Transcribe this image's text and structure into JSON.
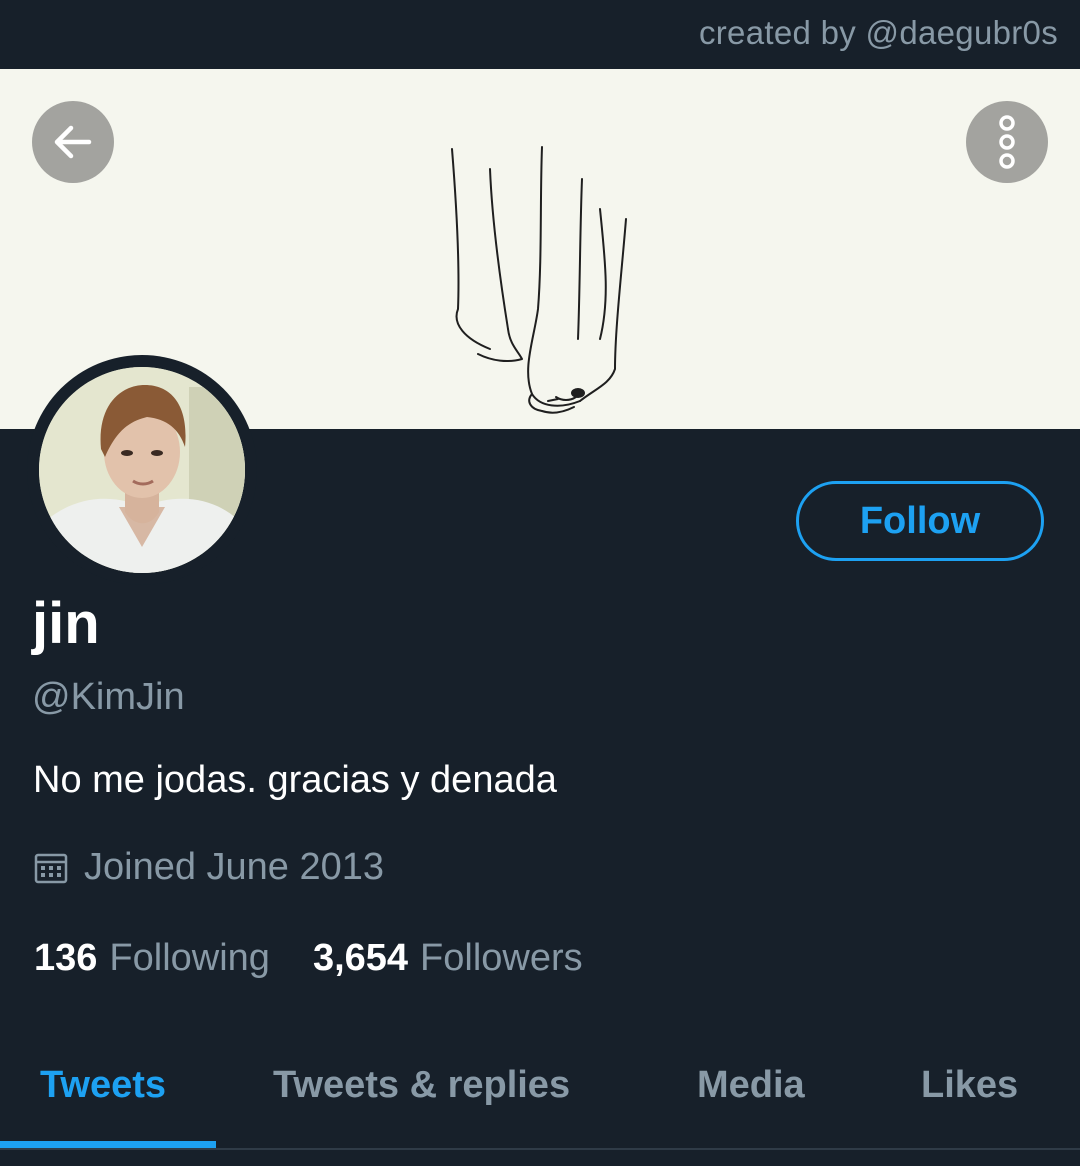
{
  "header": {
    "credit": "created by @daegubr0s"
  },
  "banner": {
    "back_icon": "arrow-left-icon",
    "more_icon": "vertical-ellipsis-icon",
    "background_color": "#f5f6ee"
  },
  "profile": {
    "name": "jin",
    "handle": "@KimJin",
    "bio": "No me jodas. gracias y denada",
    "joined": "Joined June 2013",
    "joined_icon": "calendar-icon",
    "follow_label": "Follow",
    "following_count": "136",
    "following_label": "Following",
    "followers_count": "3,654",
    "followers_label": "Followers"
  },
  "tabs": [
    {
      "label": "Tweets",
      "active": true
    },
    {
      "label": "Tweets & replies",
      "active": false
    },
    {
      "label": "Media",
      "active": false
    },
    {
      "label": "Likes",
      "active": false
    }
  ],
  "colors": {
    "background": "#17202a",
    "accent": "#1da1f2",
    "secondary_text": "#8899a6"
  }
}
